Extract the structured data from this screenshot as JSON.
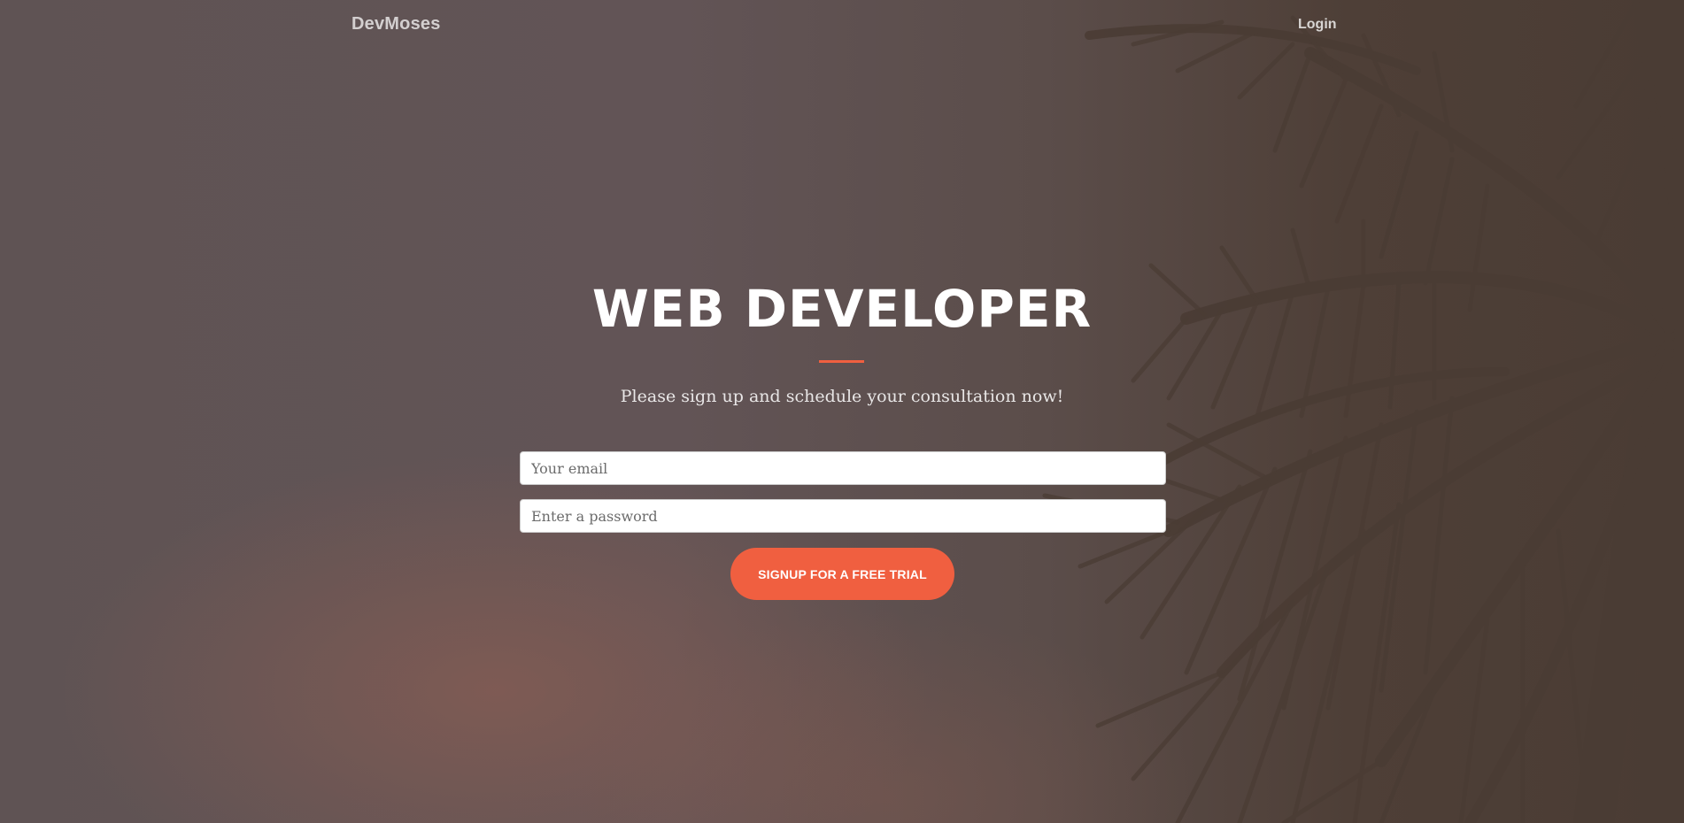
{
  "navbar": {
    "brand": "DevMoses",
    "login_label": "Login"
  },
  "hero": {
    "headline": "WEB DEVELOPER",
    "subtext": "Please sign up and schedule your consultation now!"
  },
  "form": {
    "email_placeholder": "Your email",
    "email_value": "",
    "password_placeholder": "Enter a password",
    "password_value": "",
    "signup_label": "SIGNUP FOR A FREE TRIAL"
  },
  "colors": {
    "accent": "#f05f40",
    "background": "#5e4f50",
    "palm_silhouette": "#4a3c34"
  },
  "background_image": "palm-tree-silhouette-at-dusk"
}
